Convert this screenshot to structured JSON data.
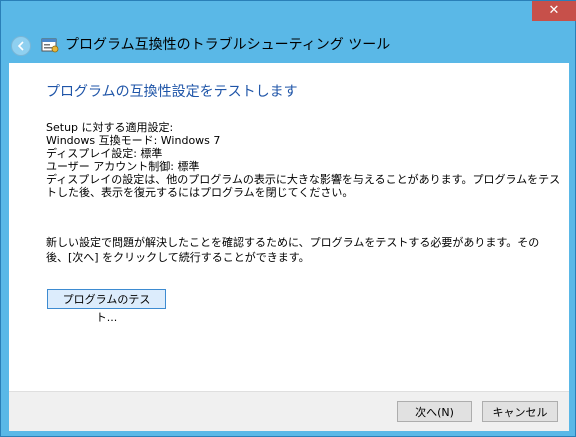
{
  "window": {
    "title": "プログラム互換性のトラブルシューティング ツール",
    "close_glyph": "✕"
  },
  "content": {
    "heading": "プログラムの互換性設定をテストします",
    "settings_header": "Setup に対する適用設定:",
    "settings": [
      "Windows 互換モード: Windows 7",
      "ディスプレイ設定:  標準",
      "ユーザー アカウント制御:  標準"
    ],
    "display_note": "ディスプレイの設定は、他のプログラムの表示に大きな影響を与えることがあります。プログラムをテストした後、表示を復元するにはプログラムを閉じてください。",
    "instruction": "新しい設定で問題が解決したことを確認するために、プログラムをテストする必要があります。その後、[次へ] をクリックして続行することができます。",
    "test_button": "プログラムのテスト..."
  },
  "footer": {
    "next_button": "次へ(N)",
    "cancel_button": "キャンセル"
  }
}
